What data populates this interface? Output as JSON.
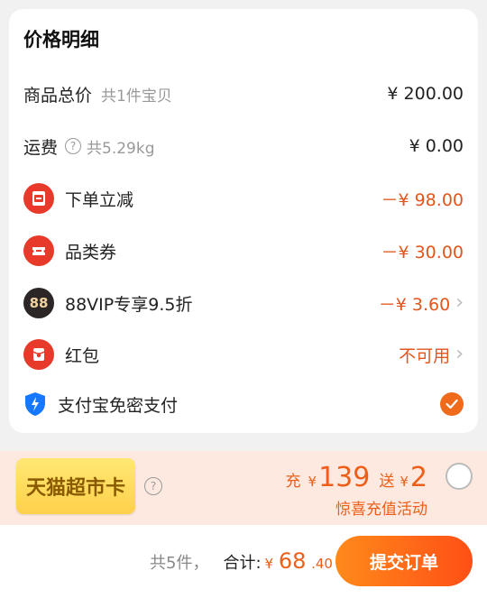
{
  "price_detail": {
    "title": "价格明细",
    "subtotal": {
      "label": "商品总价",
      "sub": "共1件宝贝",
      "value": "¥ 200.00"
    },
    "shipping": {
      "label": "运费",
      "help": "?",
      "sub": "共5.29kg",
      "value": "¥ 0.00"
    },
    "discounts": [
      {
        "label": "下单立减",
        "value": "－¥ 98.00",
        "icon": "reduce-coupon-icon"
      },
      {
        "label": "品类券",
        "value": "－¥ 30.00",
        "icon": "ticket-icon"
      },
      {
        "label": "88VIP专享9.5折",
        "value": "－¥ 3.60",
        "icon": "88vip-icon",
        "icon_text": "88"
      },
      {
        "label": "红包",
        "value": "不可用",
        "icon": "red-packet-icon"
      }
    ],
    "alipay": {
      "label": "支付宝免密支付",
      "checked": true
    }
  },
  "promo": {
    "card_label": "天猫超市卡",
    "help": "?",
    "charge_label": "充",
    "charge_yen": "¥",
    "charge_amount": "139",
    "gift_label": "送",
    "gift_yen": "¥",
    "gift_amount": "2",
    "subtitle": "惊喜充值活动",
    "selected": false
  },
  "footer": {
    "count": "共5件，",
    "total_label": "合计:",
    "yen": "¥",
    "total_int": "68",
    "total_dec": ".40",
    "submit_label": "提交订单"
  },
  "colors": {
    "accent": "#ec5f1a",
    "red_icon": "#e83a2a",
    "promo_bg": "#fde9df"
  }
}
